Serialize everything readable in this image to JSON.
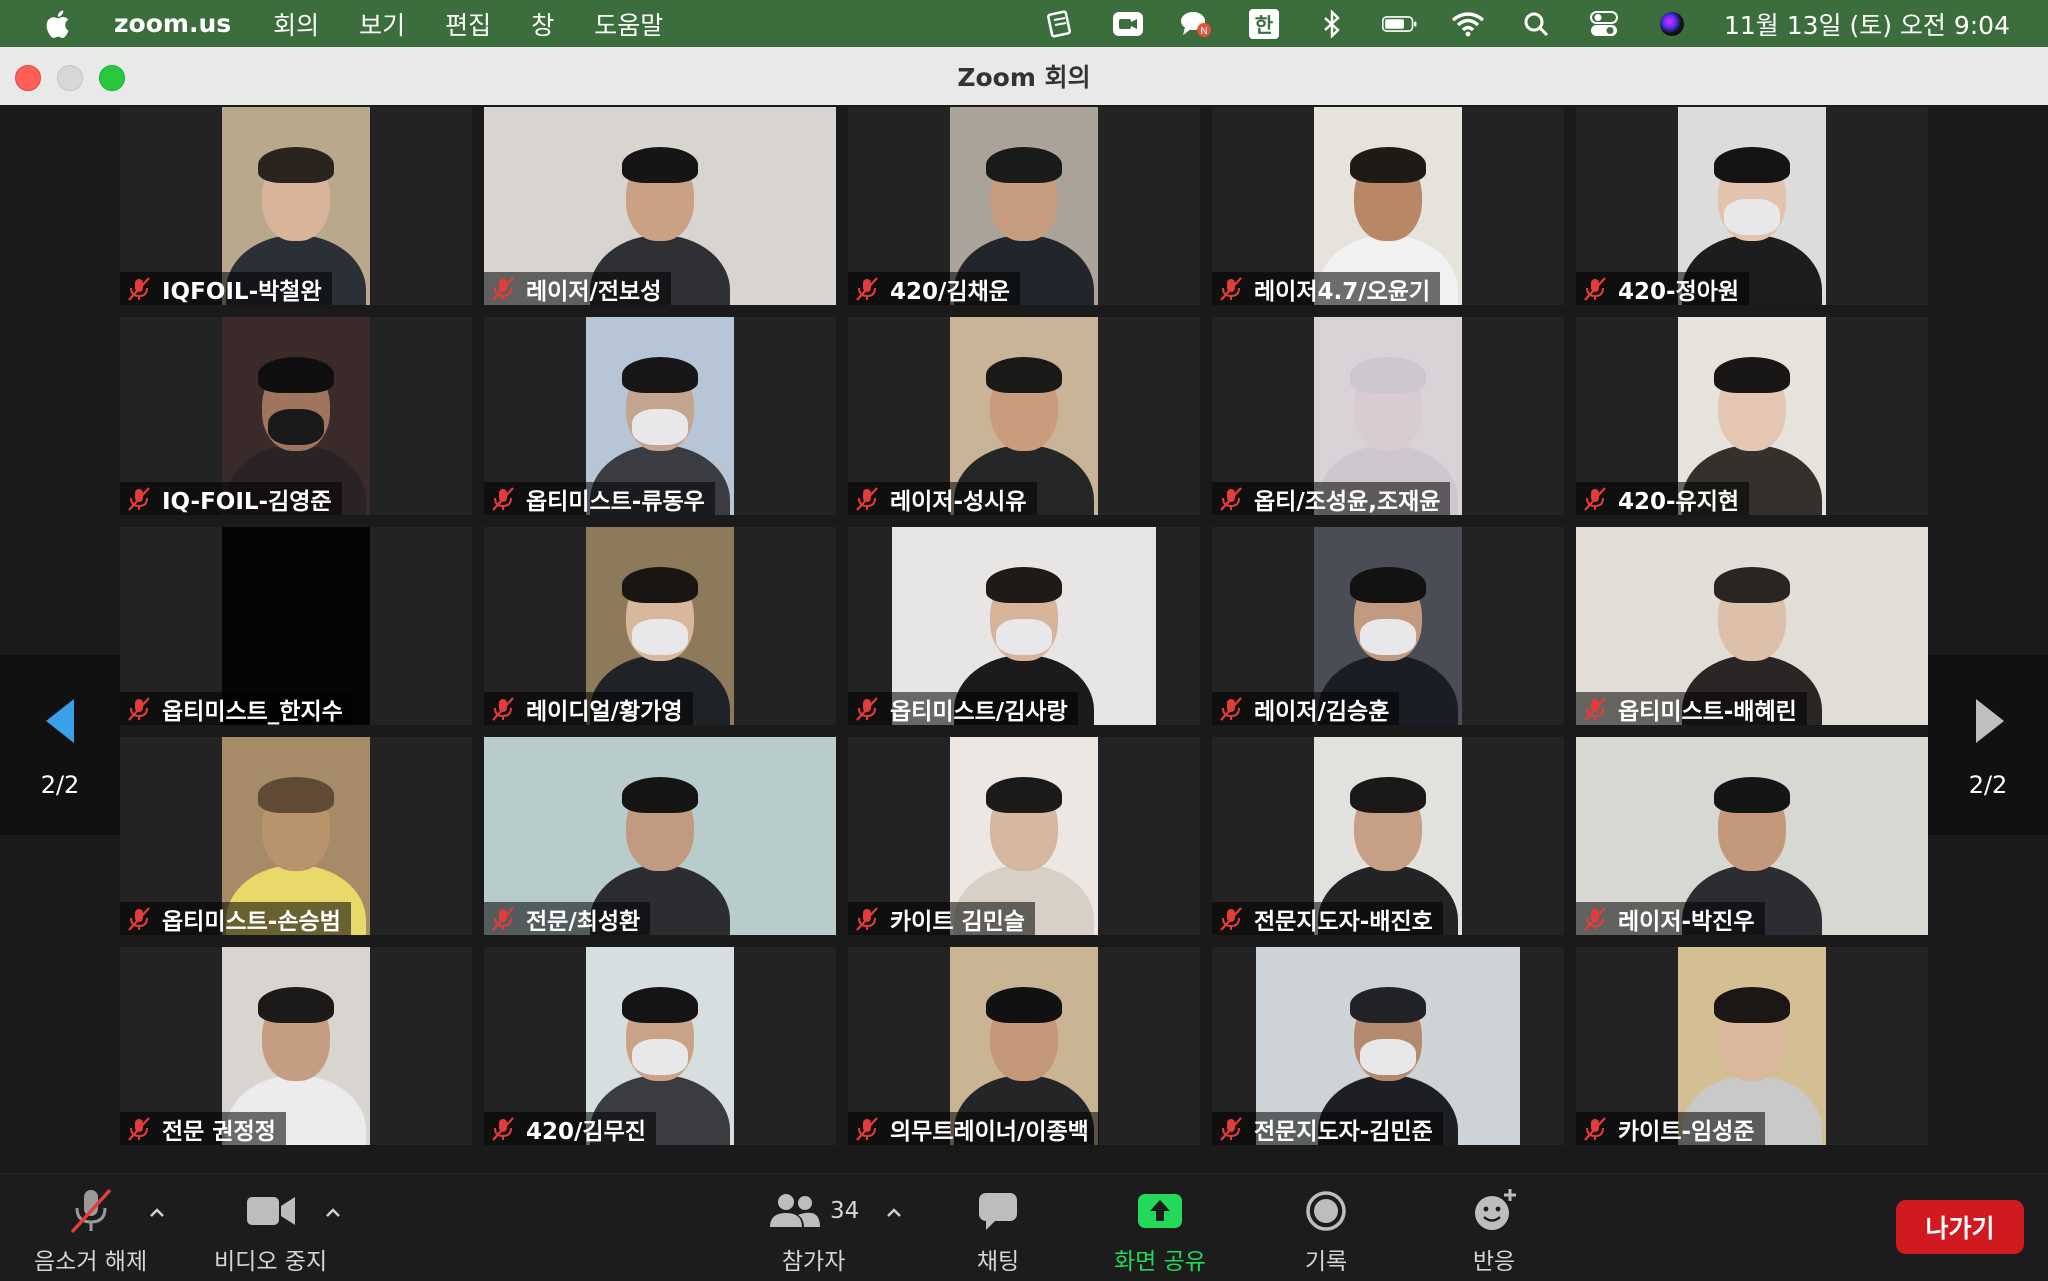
{
  "menubar": {
    "app_name": "zoom.us",
    "menus": [
      "회의",
      "보기",
      "편집",
      "창",
      "도움말"
    ],
    "kbd_label": "한",
    "clock": "11월 13일 (토) 오전  9:04"
  },
  "window": {
    "title": "Zoom 회의"
  },
  "gallery": {
    "page_label_left": "2/2",
    "page_label_right": "2/2",
    "participants": [
      {
        "name": "IQFOIL-박철완",
        "bg": "#b9a98c",
        "shirt": "#2b2f36",
        "skin": "#d9b49a",
        "hair": "#2a231e"
      },
      {
        "name": "레이저/전보성",
        "bg": "#d8d4d0",
        "shirt": "#2e3034",
        "skin": "#caa185",
        "hair": "#151515"
      },
      {
        "name": "420/김채운",
        "bg": "#a9a39a",
        "shirt": "#22262c",
        "skin": "#c89c7e",
        "hair": "#1a1a1a"
      },
      {
        "name": "레이저4.7/오윤기",
        "bg": "#e6e3dc",
        "shirt": "#f2f2f2",
        "skin": "#b88866",
        "hair": "#1f1a16"
      },
      {
        "name": "420-정아원",
        "bg": "#dcdcdc",
        "shirt": "#1d1d1f",
        "skin": "#e2c3ad",
        "hair": "#151414"
      },
      {
        "name": "IQ-FOIL-김영준",
        "bg": "#3b2a2a",
        "shirt": "#2a2224",
        "skin": "#a07560",
        "hair": "#0f0f10"
      },
      {
        "name": "옵티미스트-류동우",
        "bg": "#b7c6d6",
        "shirt": "#3a3c41",
        "skin": "#c4a690",
        "hair": "#171717"
      },
      {
        "name": "레이저-성시유",
        "bg": "#cab497",
        "shirt": "#252628",
        "skin": "#c99c7c",
        "hair": "#1b1918"
      },
      {
        "name": "옵티/조성윤,조재윤",
        "bg": "#d9d3d8",
        "shirt": "#cfc7ce",
        "skin": "#d8ccd2",
        "hair": "#cfc7ce"
      },
      {
        "name": "420-유지현",
        "bg": "#e5e3dc",
        "shirt": "#34312c",
        "skin": "#e4c7b2",
        "hair": "#181716"
      },
      {
        "name": "옵티미스트_한지수",
        "bg": "#050505",
        "shirt": "#050505",
        "skin": "#050505",
        "hair": "#050505"
      },
      {
        "name": "레이디얼/황가영",
        "bg": "#8c7a5a",
        "shirt": "#1f2327",
        "skin": "#d9b79d",
        "hair": "#181512"
      },
      {
        "name": "옵티미스트/김사랑",
        "bg": "#e7e6e4",
        "shirt": "#1b1a1c",
        "skin": "#d8b399",
        "hair": "#1e1a17"
      },
      {
        "name": "레이저/김승훈",
        "bg": "#4a4d55",
        "shirt": "#1b1d25",
        "skin": "#c29a80",
        "hair": "#121212"
      },
      {
        "name": "옵티미스트-배혜린",
        "bg": "#e2ddd6",
        "shirt": "#2a2626",
        "skin": "#dcc0aa",
        "hair": "#2a2523"
      },
      {
        "name": "옵티미스트-손승범",
        "bg": "#a58b67",
        "shirt": "#e8d96b",
        "skin": "#b8936b",
        "hair": "#5e4a35"
      },
      {
        "name": "전문/최성환",
        "bg": "#b9cccc",
        "shirt": "#2b2d30",
        "skin": "#c19a80",
        "hair": "#151515"
      },
      {
        "name": "카이트 김민슬",
        "bg": "#ece7e2",
        "shirt": "#d8cfc6",
        "skin": "#d6b8a0",
        "hair": "#1a1a1a"
      },
      {
        "name": "전문지도자-배진호",
        "bg": "#e3e1dd",
        "shirt": "#222324",
        "skin": "#c69f84",
        "hair": "#1a1818"
      },
      {
        "name": "레이저-박진우",
        "bg": "#d7d8d2",
        "shirt": "#2b2d33",
        "skin": "#c4987a",
        "hair": "#151515"
      },
      {
        "name": "전문 권정정",
        "bg": "#d8d4cf",
        "shirt": "#ececec",
        "skin": "#c59d80",
        "hair": "#1c1a18"
      },
      {
        "name": "420/김무진",
        "bg": "#d6dee0",
        "shirt": "#3a3c40",
        "skin": "#c9a288",
        "hair": "#141414"
      },
      {
        "name": "의무트레이너/이종백",
        "bg": "#c9b593",
        "shirt": "#242526",
        "skin": "#c39777",
        "hair": "#111111"
      },
      {
        "name": "전문지도자-김민준",
        "bg": "#cdd3d6",
        "shirt": "#1e1f22",
        "skin": "#b48a6e",
        "hair": "#222326"
      },
      {
        "name": "카이트-임성준",
        "bg": "#d4bf95",
        "shirt": "#c9c9c9",
        "skin": "#dab99f",
        "hair": "#1a1714"
      }
    ]
  },
  "toolbar": {
    "unmute_label": "음소거 해제",
    "stop_video_label": "비디오 중지",
    "participants_label": "참가자",
    "participants_count": "34",
    "chat_label": "채팅",
    "share_label": "화면 공유",
    "record_label": "기록",
    "reactions_label": "반응",
    "leave_label": "나가기"
  },
  "colors": {
    "menubar_bg": "#3b6e3c",
    "share_green": "#23d959",
    "leave_red": "#d11a1f",
    "nav_arrow_active": "#3aa0e8",
    "muted_icon_red": "#e53b3b"
  }
}
